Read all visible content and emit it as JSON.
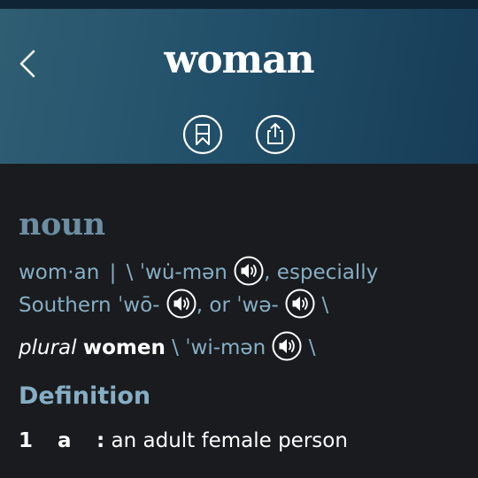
{
  "header": {
    "title": "woman",
    "back_icon": "chevron-left-icon",
    "actions": [
      {
        "name": "bookmark",
        "icon": "bookmark-icon"
      },
      {
        "name": "share",
        "icon": "share-icon"
      }
    ]
  },
  "entry": {
    "part_of_speech": "noun",
    "syllables": "wom·an",
    "divider": "|",
    "pron1": "\\ ˈwu̇-mən",
    "pron1_suffix": ", especially",
    "region": "Southern",
    "pron2": "ˈwō-",
    "pron2_suffix": ", or",
    "pron3": "ˈwə-",
    "pron3_suffix": "\\",
    "plural_label": "plural",
    "plural_word": "women",
    "plural_pron": "\\ ˈwi-mən",
    "plural_suffix": "\\"
  },
  "definition": {
    "heading": "Definition",
    "senses": [
      {
        "number": "1",
        "letter": "a",
        "colon": ":",
        "text": "an adult female person"
      }
    ]
  },
  "colors": {
    "header_start": "#2f5e73",
    "header_end": "#173c57",
    "background": "#1a1b1e",
    "accent_text": "#86aec4",
    "pos_text": "#6b8ea3",
    "primary_text": "#ffffff"
  }
}
